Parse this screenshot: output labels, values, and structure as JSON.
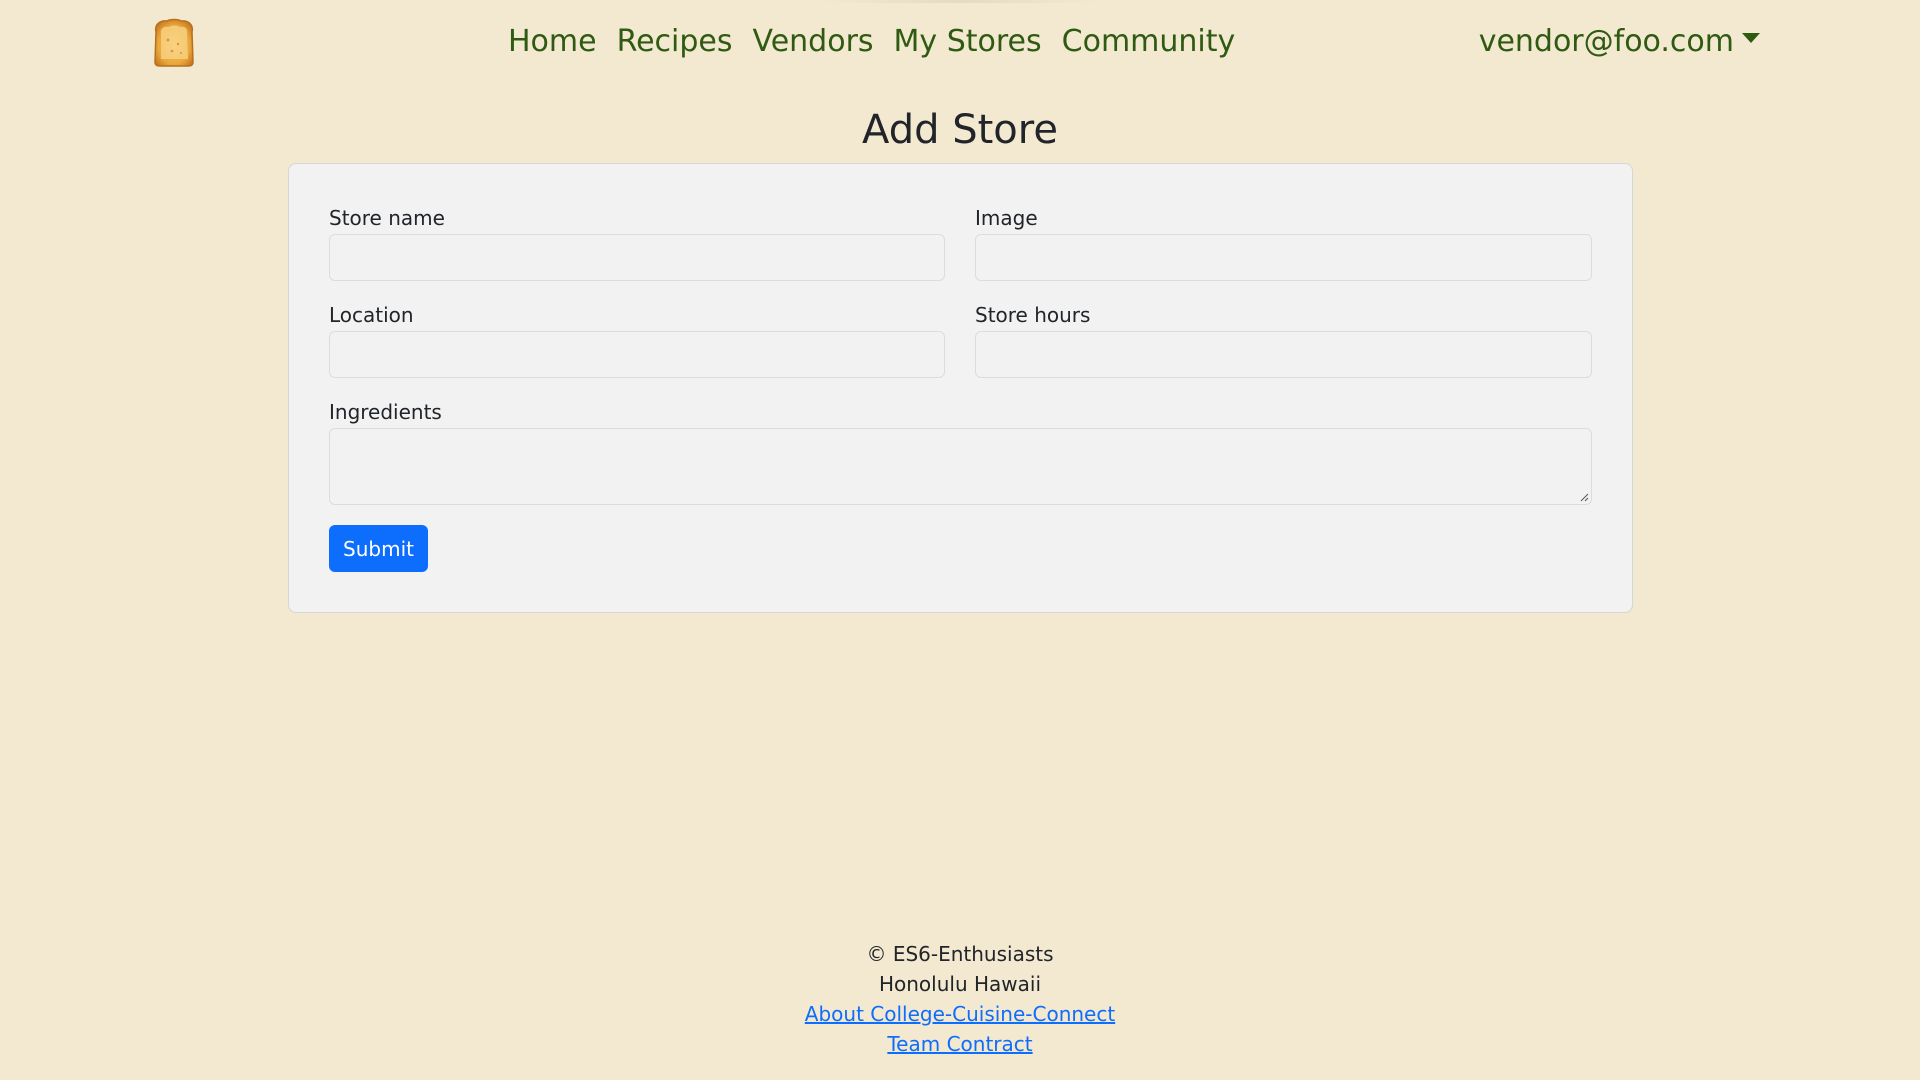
{
  "nav": {
    "logo_icon": "toast-bread-icon",
    "links": [
      {
        "label": "Home"
      },
      {
        "label": "Recipes"
      },
      {
        "label": "Vendors"
      },
      {
        "label": "My Stores"
      },
      {
        "label": "Community"
      }
    ],
    "user_email": "vendor@foo.com"
  },
  "page": {
    "title": "Add Store"
  },
  "form": {
    "store_name": {
      "label": "Store name",
      "value": "",
      "placeholder": ""
    },
    "image": {
      "label": "Image",
      "value": "",
      "placeholder": ""
    },
    "location": {
      "label": "Location",
      "value": "",
      "placeholder": ""
    },
    "store_hours": {
      "label": "Store hours",
      "value": "",
      "placeholder": ""
    },
    "ingredients": {
      "label": "Ingredients",
      "value": "",
      "placeholder": ""
    },
    "submit_label": "Submit"
  },
  "footer": {
    "copyright": "© ES6-Enthusiasts",
    "location": "Honolulu Hawaii",
    "about_link": "About College-Cuisine-Connect",
    "contract_link": "Team Contract"
  },
  "colors": {
    "background": "#f3e8d0",
    "nav_text": "#2f5a12",
    "primary_button": "#0d6efd",
    "card_background": "#f2f2f2"
  }
}
